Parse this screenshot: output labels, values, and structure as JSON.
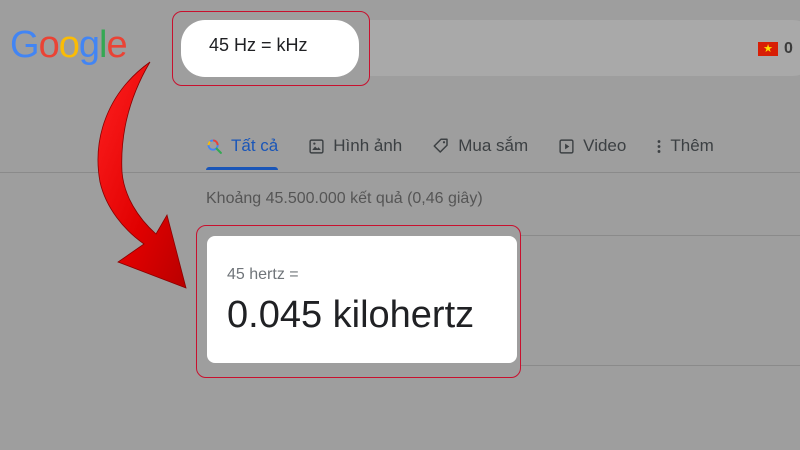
{
  "logo": {
    "letters": [
      "G",
      "o",
      "o",
      "g",
      "l",
      "e"
    ],
    "colors": [
      "#4285f4",
      "#ea4335",
      "#fbbc05",
      "#4285f4",
      "#34a853",
      "#ea4335"
    ]
  },
  "search": {
    "query": "45 Hz = kHz"
  },
  "region": {
    "count": "0"
  },
  "tabs": [
    {
      "label": "Tất cả",
      "icon": "search-icon",
      "active": true
    },
    {
      "label": "Hình ảnh",
      "icon": "image-icon",
      "active": false
    },
    {
      "label": "Mua sắm",
      "icon": "tag-icon",
      "active": false
    },
    {
      "label": "Video",
      "icon": "play-icon",
      "active": false
    },
    {
      "label": "Thêm",
      "icon": "more-vertical-icon",
      "active": false
    }
  ],
  "results": {
    "stats": "Khoảng 45.500.000 kết quả (0,46 giây)"
  },
  "converter": {
    "from": "45 hertz =",
    "to": "0.045 kilohertz"
  },
  "colors": {
    "highlight": "#c8102e",
    "arrow": "#e00000",
    "active_tab": "#1a56b8"
  }
}
